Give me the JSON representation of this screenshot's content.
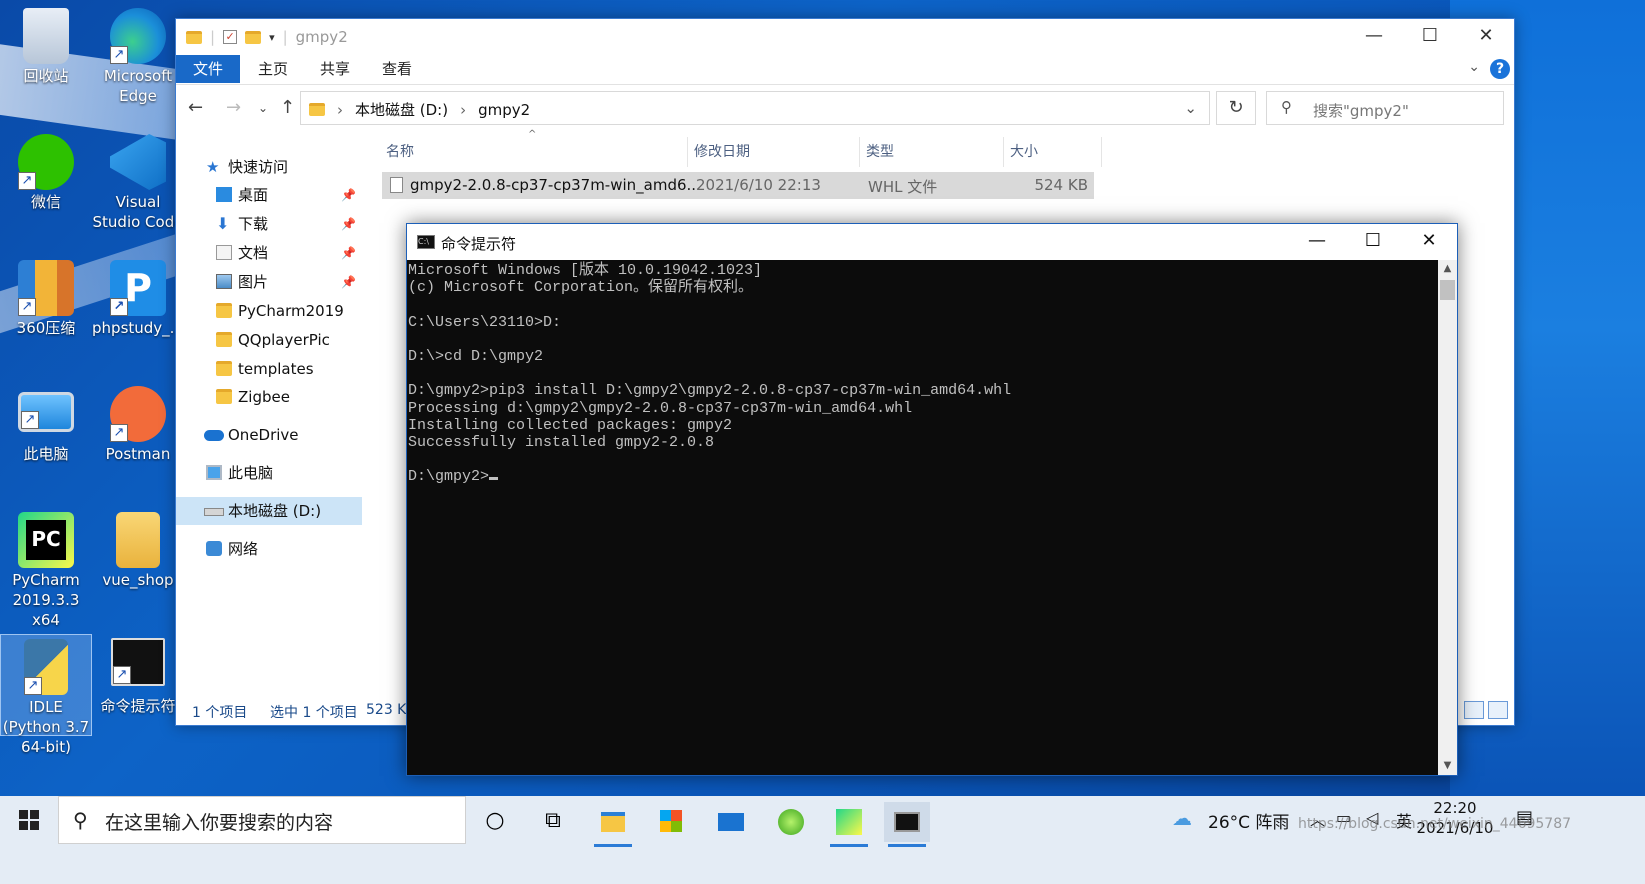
{
  "desktop": {
    "icons": [
      {
        "label": "回收站"
      },
      {
        "label": "Microsoft Edge"
      },
      {
        "label": "微信"
      },
      {
        "label": "Visual Studio Code"
      },
      {
        "label": "360压缩"
      },
      {
        "label": "phpstudy_..."
      },
      {
        "label": "此电脑"
      },
      {
        "label": "Postman"
      },
      {
        "label": "PyCharm 2019.3.3 x64"
      },
      {
        "label": "vue_shop"
      },
      {
        "label": "IDLE (Python 3.7 64-bit)"
      },
      {
        "label": "命令提示符"
      }
    ]
  },
  "explorer": {
    "title": "gmpy2",
    "ribbon_tabs": [
      "文件",
      "主页",
      "共享",
      "查看"
    ],
    "address": {
      "parts": [
        "本地磁盘 (D:)",
        "gmpy2"
      ]
    },
    "search_placeholder": "搜索\"gmpy2\"",
    "nav": [
      {
        "label": "快速访问",
        "pinned": false
      },
      {
        "label": "桌面",
        "pinned": true
      },
      {
        "label": "下载",
        "pinned": true
      },
      {
        "label": "文档",
        "pinned": true
      },
      {
        "label": "图片",
        "pinned": true
      },
      {
        "label": "PyCharm2019",
        "pinned": false
      },
      {
        "label": "QQplayerPic",
        "pinned": false
      },
      {
        "label": "templates",
        "pinned": false
      },
      {
        "label": "Zigbee",
        "pinned": false
      },
      {
        "label": "OneDrive",
        "pinned": false
      },
      {
        "label": "此电脑",
        "pinned": false
      },
      {
        "label": "本地磁盘 (D:)",
        "pinned": false
      },
      {
        "label": "网络",
        "pinned": false
      }
    ],
    "columns": [
      "名称",
      "修改日期",
      "类型",
      "大小"
    ],
    "files": [
      {
        "name": "gmpy2-2.0.8-cp37-cp37m-win_amd6...",
        "date": "2021/6/10 22:13",
        "type": "WHL 文件",
        "size": "524 KB"
      }
    ],
    "status": {
      "count": "1 个项目",
      "selected": "选中 1 个项目",
      "size": "523 K"
    }
  },
  "cmd": {
    "title": "命令提示符",
    "lines": [
      "Microsoft Windows [版本 10.0.19042.1023]",
      "(c) Microsoft Corporation。保留所有权利。",
      "",
      "C:\\Users\\23110>D:",
      "",
      "D:\\>cd D:\\gmpy2",
      "",
      "D:\\gmpy2>pip3 install D:\\gmpy2\\gmpy2-2.0.8-cp37-cp37m-win_amd64.whl",
      "Processing d:\\gmpy2\\gmpy2-2.0.8-cp37-cp37m-win_amd64.whl",
      "Installing collected packages: gmpy2",
      "Successfully installed gmpy2-2.0.8",
      ""
    ],
    "prompt": "D:\\gmpy2>"
  },
  "taskbar": {
    "search_placeholder": "在这里输入你要搜索的内容",
    "weather": "26°C 阵雨",
    "ime": "英",
    "time": "22:20",
    "date": "2021/6/10",
    "watermark": "https://blog.csdn.net/weixin_44695787"
  }
}
